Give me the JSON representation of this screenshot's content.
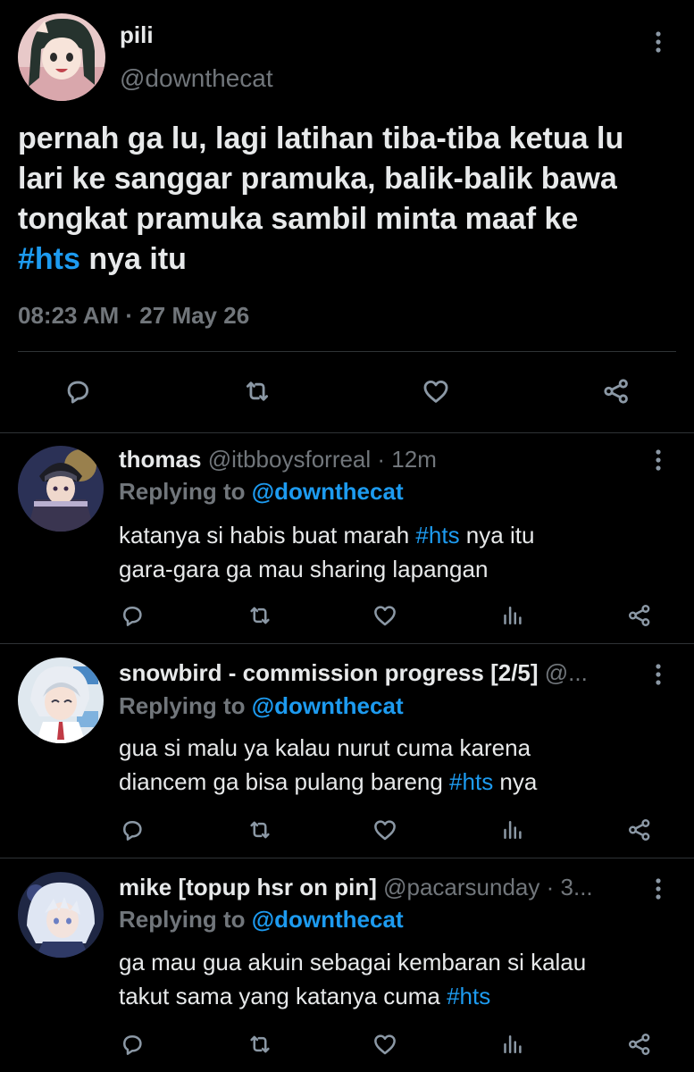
{
  "main_tweet": {
    "display_name": "pili",
    "handle": "@downthecat",
    "text_lines": [
      "pernah ga lu, lagi latihan tiba-tiba ketua lu",
      "lari ke sanggar pramuka, balik-balik bawa",
      "tongkat pramuka sambil minta maaf ke"
    ],
    "hashtag": "#hts",
    "text_tail": " nya itu",
    "timestamp": "08:23 AM · 27 May 26"
  },
  "replies": [
    {
      "display_name": "thomas",
      "handle": "@itbboysforreal",
      "time": "· 12m",
      "replying_prefix": "Replying to",
      "replying_handle": "@downthecat",
      "line1_pre": "katanya si habis buat marah ",
      "line1_tag": "#hts",
      "line1_post": " nya itu",
      "line2_pre": "gara-gara ga mau sharing lapangan",
      "line2_tag": "",
      "line2_post": ""
    },
    {
      "display_name": "snowbird - commission progress [2/5]",
      "handle": "@...",
      "time": "",
      "replying_prefix": "Replying to",
      "replying_handle": "@downthecat",
      "line1_pre": "gua si malu ya kalau nurut cuma karena",
      "line1_tag": "",
      "line1_post": "",
      "line2_pre": "diancem ga bisa pulang bareng ",
      "line2_tag": "#hts",
      "line2_post": " nya"
    },
    {
      "display_name": "mike [topup hsr on pin]",
      "handle": "@pacarsunday",
      "time": "· 3...",
      "replying_prefix": "Replying to",
      "replying_handle": "@downthecat",
      "line1_pre": "ga mau gua akuin sebagai kembaran si kalau",
      "line1_tag": "",
      "line1_post": "",
      "line2_pre": "takut sama yang katanya cuma ",
      "line2_tag": "#hts",
      "line2_post": ""
    }
  ],
  "icons": {
    "reply": "comment-icon",
    "retweet": "retweet-icon",
    "like": "heart-icon",
    "views": "analytics-icon",
    "share": "share-icon",
    "more": "more-vertical-icon"
  },
  "colors": {
    "background": "#000000",
    "text": "#e7e9ea",
    "muted": "#71767b",
    "accent": "#1d9bf0",
    "divider": "#2f3336"
  }
}
